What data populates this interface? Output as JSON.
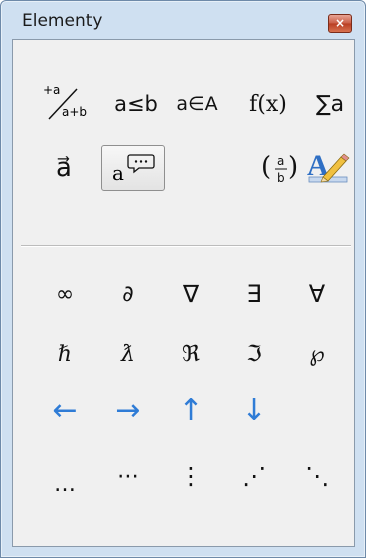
{
  "window": {
    "title": "Elementy",
    "close_label": "×"
  },
  "categories": [
    {
      "id": "unary-binary",
      "label_top": "+a",
      "label_bottom": "a+b"
    },
    {
      "id": "relations",
      "label": "a≤b"
    },
    {
      "id": "set-operations",
      "label": "a∈A"
    },
    {
      "id": "functions",
      "label": "f(x)"
    },
    {
      "id": "operators",
      "label": "∑a"
    },
    {
      "id": "attributes",
      "label": "a⃗"
    },
    {
      "id": "others",
      "label": "a",
      "selected": true
    },
    {
      "id": "brackets",
      "label": "(ᵃ⁄ᵦ)"
    },
    {
      "id": "formats",
      "label": "A"
    }
  ],
  "symbols": {
    "row1": [
      "∞",
      "∂",
      "∇",
      "∃",
      "∀"
    ],
    "row2": [
      "ℏ",
      "ƛ",
      "ℜ",
      "ℑ",
      "℘"
    ],
    "row3": [
      "←",
      "→",
      "↑",
      "↓"
    ],
    "row4": [
      "…",
      "⋯",
      "⋮",
      "⋰",
      "⋱"
    ]
  },
  "colors": {
    "arrow": "#2f7cd6",
    "frame": "#cfe0f1",
    "close": "#c95b44"
  }
}
